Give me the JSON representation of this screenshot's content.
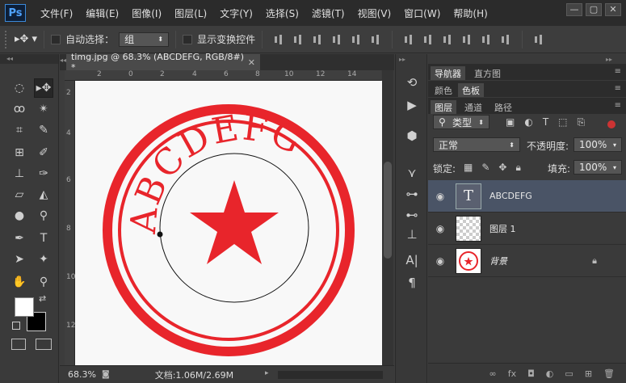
{
  "app": {
    "logo": "Ps",
    "menu": [
      "文件(F)",
      "编辑(E)",
      "图像(I)",
      "图层(L)",
      "文字(Y)",
      "选择(S)",
      "滤镜(T)",
      "视图(V)",
      "窗口(W)",
      "帮助(H)"
    ],
    "window_controls": [
      "—",
      "▢",
      "✕"
    ]
  },
  "options_bar": {
    "auto_select_label": "自动选择：",
    "auto_select_value": "组",
    "show_transform_label": "显示变换控件"
  },
  "document": {
    "tab_title": "timg.jpg @ 68.3% (ABCDEFG, RGB/8#) *",
    "ruler_top": [
      "2",
      "0",
      "2",
      "4",
      "6",
      "8",
      "10",
      "12",
      "14"
    ],
    "ruler_left": [
      "2",
      "4",
      "6",
      "8",
      "10",
      "12"
    ],
    "stamp_text": "ABCDEFG",
    "zoom": "68.3%",
    "doc_info": "文档:1.06M/2.69M"
  },
  "panels": {
    "navigator_tabs": [
      "导航器",
      "直方图"
    ],
    "color_tabs": [
      "颜色",
      "色板"
    ],
    "layer_tabs": [
      "图层",
      "通道",
      "路径"
    ],
    "kind_filter": "类型",
    "blend_mode": "正常",
    "opacity_label": "不透明度:",
    "opacity_value": "100%",
    "lock_label": "锁定:",
    "fill_label": "填充:",
    "fill_value": "100%",
    "layers": [
      {
        "name": "ABCDEFG"
      },
      {
        "name": "图层 1"
      },
      {
        "name": "背景"
      }
    ],
    "bottom_icons": [
      "∞",
      "fx"
    ]
  },
  "colors": {
    "stamp_red": "#e8252b",
    "selected_layer": "#4a5466"
  }
}
